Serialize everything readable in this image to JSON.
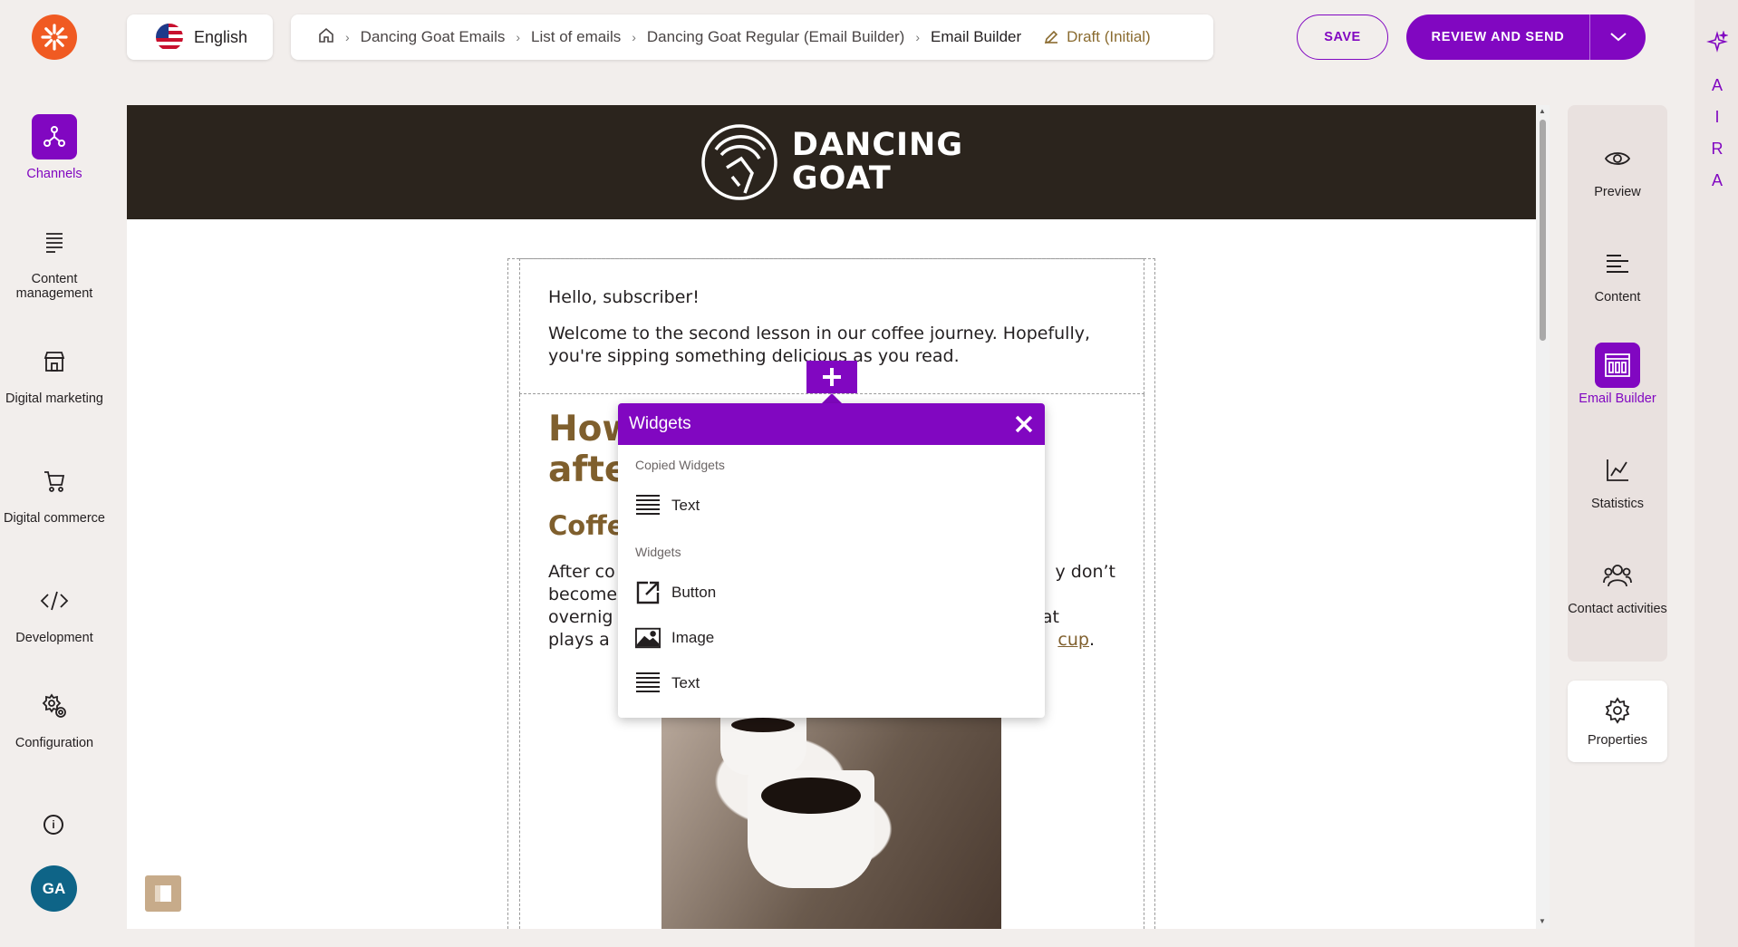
{
  "nav": {
    "items": [
      {
        "label": "Channels",
        "icon": "channels-icon"
      },
      {
        "label": "Content management",
        "icon": "content-management-icon"
      },
      {
        "label": "Digital marketing",
        "icon": "digital-marketing-icon"
      },
      {
        "label": "Digital commerce",
        "icon": "cart-icon"
      },
      {
        "label": "Development",
        "icon": "code-icon"
      },
      {
        "label": "Configuration",
        "icon": "gear-icon"
      }
    ],
    "avatar": "GA",
    "info": "i"
  },
  "language": {
    "label": "English"
  },
  "breadcrumb": {
    "items": [
      "Dancing Goat Emails",
      "List of emails",
      "Dancing Goat Regular (Email Builder)",
      "Email Builder"
    ],
    "status": "Draft (Initial)"
  },
  "toolbar": {
    "save": "SAVE",
    "review": "REVIEW AND SEND"
  },
  "aira": {
    "letters": [
      "A",
      "I",
      "R",
      "A"
    ]
  },
  "right_panel": {
    "items": [
      {
        "label": "Preview"
      },
      {
        "label": "Content"
      },
      {
        "label": "Email Builder"
      },
      {
        "label": "Statistics"
      },
      {
        "label": "Contact activities"
      }
    ],
    "properties": "Properties"
  },
  "email": {
    "brand_line1": "DANCING",
    "brand_line2": "GOAT",
    "greeting": "Hello, subscriber!",
    "intro": "Welcome to the second lesson in our coffee journey. Hopefully, you're sipping something delicious as you read.",
    "heading_visible": "How",
    "heading_visible2": "afte",
    "subheading_visible": "Coffe",
    "body_left": [
      "After co",
      "become",
      "overnig",
      "plays a"
    ],
    "body_right_1": "y don’t",
    "body_right_3": "at",
    "body_link": "cup",
    "body_link_end": "."
  },
  "widgets": {
    "title": "Widgets",
    "copied_label": "Copied Widgets",
    "copied": [
      {
        "label": "Text",
        "icon": "text-icon"
      }
    ],
    "widgets_label": "Widgets",
    "items": [
      {
        "label": "Button",
        "icon": "external-link-icon"
      },
      {
        "label": "Image",
        "icon": "image-icon"
      },
      {
        "label": "Text",
        "icon": "text-icon"
      }
    ]
  },
  "colors": {
    "accent": "#8107c1",
    "brand_orange": "#f05a22",
    "heading_brown": "#7f5f2d",
    "header_dark": "#2b241d"
  }
}
